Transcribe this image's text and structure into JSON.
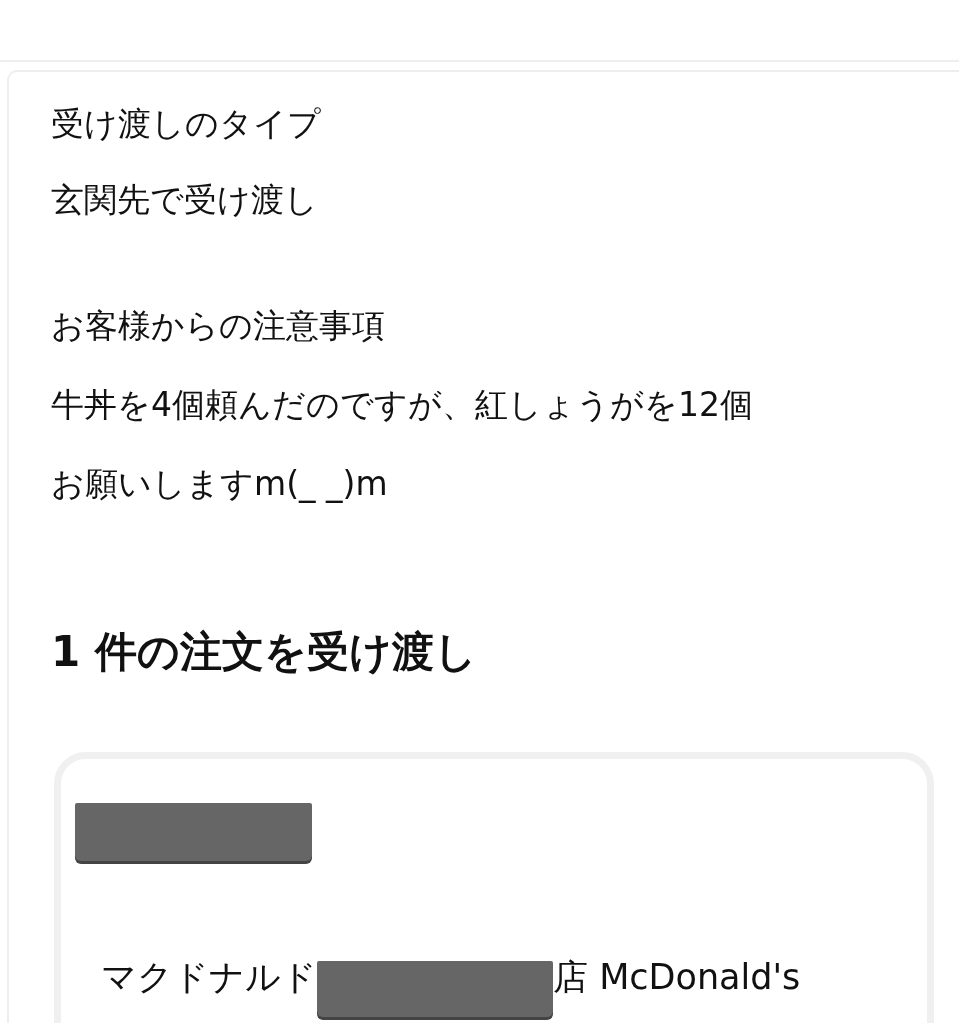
{
  "delivery_type": {
    "label": "受け渡しのタイプ",
    "value": "玄関先で受け渡し"
  },
  "customer_notes": {
    "label": "お客様からの注意事項",
    "lines": [
      "牛丼を4個頼んだのですが、紅しょうがを12個",
      "お願いしますm(_ _)m"
    ]
  },
  "orders_heading": "1 件の注文を受け渡し",
  "order_card": {
    "store_name_start": "マクドナルド",
    "store_name_end": "店 McDonald's"
  }
}
